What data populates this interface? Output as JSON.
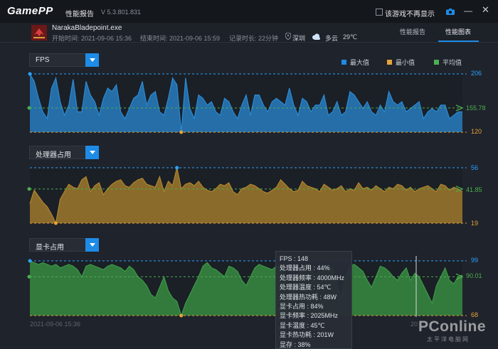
{
  "titlebar": {
    "logo": "GamePP",
    "title": "性能报告",
    "version": "V 5.3.801.831",
    "hide_label": "该游戏不再显示"
  },
  "info": {
    "game_name": "NarakaBladepoint.exe",
    "start_time": "开始时间: 2021-09-06 15:36",
    "end_time": "结束时间: 2021-09-06 15:59",
    "duration": "记录时长: 22分钟",
    "location": "深圳",
    "weather": "多云",
    "temperature": "29℃"
  },
  "tabs": [
    {
      "label": "性能报告",
      "active": false
    },
    {
      "label": "性能图表",
      "active": true
    }
  ],
  "legend": [
    {
      "label": "最大值",
      "color": "#1e8be6"
    },
    {
      "label": "最小值",
      "color": "#e6a23c"
    },
    {
      "label": "平均值",
      "color": "#4caf50"
    }
  ],
  "colors": {
    "max": "#2aa3ff",
    "min": "#e6a23c",
    "avg": "#4caf50",
    "accent": "#1e8be6"
  },
  "chart_data": [
    {
      "type": "area",
      "metric": "FPS",
      "max": 206,
      "min": 120,
      "avg": 155.78,
      "max_label": "206",
      "min_label": "120",
      "avg_label": "155.78",
      "ylim": [
        120,
        206
      ],
      "color": "#2a8ad4",
      "values": [
        206,
        195,
        170,
        150,
        140,
        185,
        200,
        165,
        145,
        160,
        198,
        150,
        150,
        195,
        175,
        165,
        145,
        170,
        185,
        180,
        190,
        150,
        140,
        155,
        170,
        175,
        195,
        160,
        175,
        180,
        150,
        145,
        170,
        200,
        190,
        120,
        200,
        155,
        140,
        175,
        170,
        160,
        165,
        150,
        145,
        170,
        165,
        150,
        140,
        160,
        175,
        145,
        175,
        175,
        160,
        150,
        165,
        170,
        165,
        160,
        185,
        160,
        145,
        170,
        165,
        150,
        160,
        160,
        175,
        145,
        150,
        165,
        145,
        150,
        180,
        175,
        165,
        155,
        165,
        150,
        145,
        160,
        150,
        180,
        165,
        160,
        165,
        150,
        155,
        160,
        165,
        140,
        150,
        155,
        150,
        160,
        160,
        140,
        145,
        150,
        150
      ]
    },
    {
      "type": "area",
      "metric": "处理器占用",
      "max": 56,
      "min": 19,
      "avg": 41.85,
      "max_label": "56",
      "min_label": "19",
      "avg_label": "41.85",
      "ylim": [
        19,
        56
      ],
      "color": "#b0852e",
      "values": [
        32,
        41,
        37,
        33,
        30,
        25,
        19,
        35,
        40,
        45,
        43,
        42,
        48,
        50,
        40,
        44,
        46,
        38,
        42,
        45,
        47,
        48,
        44,
        43,
        46,
        48,
        49,
        45,
        44,
        43,
        50,
        40,
        47,
        44,
        56,
        42,
        45,
        46,
        44,
        47,
        43,
        41,
        40,
        42,
        45,
        44,
        46,
        40,
        38,
        42,
        43,
        45,
        44,
        42,
        40,
        39,
        41,
        43,
        48,
        45,
        42,
        40,
        41,
        47,
        44,
        43,
        42,
        40,
        45,
        43,
        41,
        42,
        44,
        40,
        42,
        41,
        46,
        42,
        43,
        41,
        44,
        42,
        40,
        43,
        42,
        45,
        44,
        41,
        43,
        40,
        42,
        43,
        44,
        42,
        40,
        45,
        44,
        41,
        43,
        42,
        40
      ]
    },
    {
      "type": "area",
      "metric": "显卡占用",
      "max": 99,
      "min": 68,
      "avg": 90.01,
      "max_label": "99",
      "min_label": "68",
      "avg_label": "90.01",
      "ylim": [
        68,
        99
      ],
      "color": "#3c9a46",
      "values": [
        99,
        98,
        97,
        98,
        97,
        96,
        97,
        95,
        96,
        97,
        96,
        94,
        90,
        96,
        97,
        96,
        95,
        94,
        96,
        97,
        96,
        95,
        93,
        96,
        94,
        90,
        88,
        85,
        80,
        78,
        84,
        90,
        82,
        78,
        76,
        68,
        75,
        80,
        85,
        90,
        96,
        98,
        95,
        94,
        92,
        90,
        96,
        95,
        93,
        88,
        85,
        90,
        95,
        97,
        96,
        95,
        94,
        96,
        97,
        90,
        85,
        88,
        92,
        96,
        97,
        95,
        90,
        94,
        96,
        97,
        95,
        85,
        78,
        90,
        96,
        97,
        95,
        93,
        88,
        84,
        90,
        96,
        95,
        93,
        90,
        88,
        92,
        95,
        88,
        92,
        90,
        85,
        80,
        75,
        85,
        90,
        95,
        88,
        86,
        90,
        91
      ]
    }
  ],
  "selectors": {
    "fps": "FPS",
    "cpu": "处理器占用",
    "gpu": "显卡占用"
  },
  "dates": {
    "start": "2021-09-06 15:36",
    "end_partial": "20"
  },
  "tooltip": [
    "FPS : 148",
    "处理器占用 : 44%",
    "处理器频率 : 4000MHz",
    "处理器温度 : 54℃",
    "处理器热功耗 : 48W",
    "显卡占用 : 84%",
    "显卡频率 : 2025MHz",
    "显卡温度 : 45℃",
    "显卡热功耗 : 201W",
    "显存 : 38%"
  ],
  "watermark": {
    "brand": "PConline",
    "sub": "太平洋电脑网"
  }
}
